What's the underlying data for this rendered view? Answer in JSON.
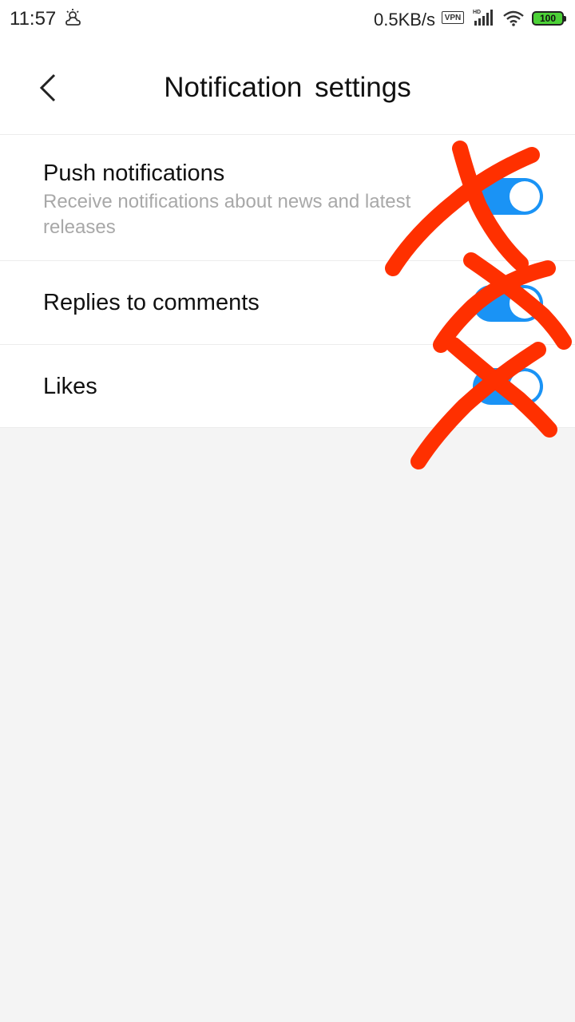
{
  "status_bar": {
    "time": "11:57",
    "weather_icon": "partly-cloudy-icon",
    "network_speed": "0.5KB/s",
    "vpn_label": "VPN",
    "battery_level": "100",
    "battery_color": "#4cd137"
  },
  "header": {
    "back_icon": "chevron-left-icon",
    "title": "Notification  settings"
  },
  "settings": [
    {
      "label": "Push notifications",
      "description": "Receive notifications about news and latest releases",
      "enabled": true
    },
    {
      "label": "Replies to comments",
      "enabled": true
    },
    {
      "label": "Likes",
      "enabled": true
    }
  ],
  "colors": {
    "toggle_on": "#1a93f5",
    "annotation": "#ff3000"
  }
}
